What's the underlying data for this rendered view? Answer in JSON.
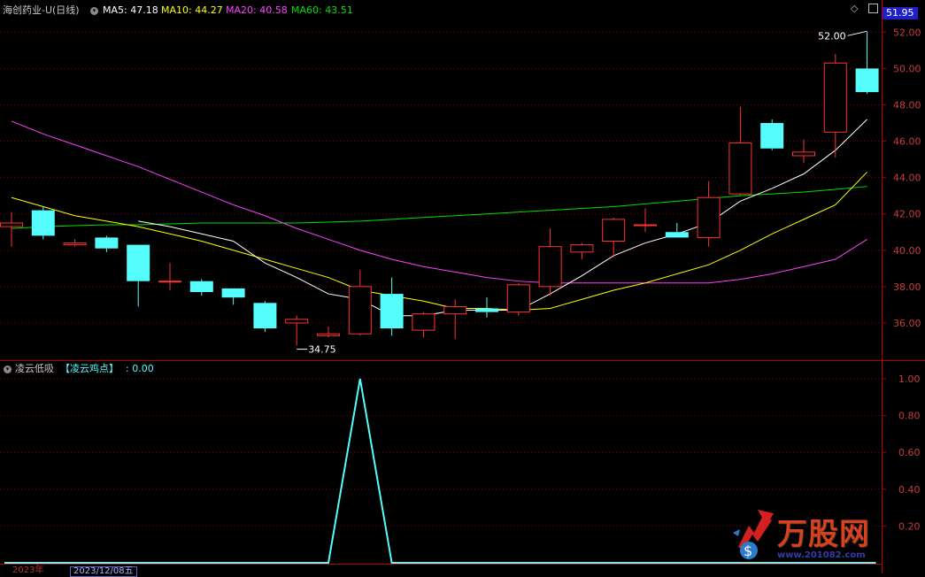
{
  "header": {
    "stock_name": "海创药业-U(日线)",
    "ma": [
      {
        "label": "MA5: 47.18",
        "color": "#ffffff"
      },
      {
        "label": "MA10: 44.27",
        "color": "#ffff00"
      },
      {
        "label": "MA20: 40.58",
        "color": "#ff40ff"
      },
      {
        "label": "MA60: 43.51",
        "color": "#00e000"
      }
    ],
    "last_price": "51.95"
  },
  "indicator": {
    "name": "凌云低吸",
    "series_label": "【凌云鸡点】",
    "value_label": ": 0.00"
  },
  "bottom_bar": {
    "year_label": "2023年",
    "date_label": "2023/12/08五"
  },
  "watermark": {
    "text": "万股网",
    "url": "www.201082.com"
  },
  "colors": {
    "up": "#ff3232",
    "down": "#54fcfc",
    "grid": "#7a0000",
    "axis": "#b00000",
    "axis_text": "#c83c3c",
    "ma5": "#ffffff",
    "ma10": "#ffff00",
    "ma20": "#ff40ff",
    "ma60": "#00e000",
    "indicator": "#54fcfc",
    "name": "#c8c8c8",
    "indicator_text": "#54fcfc"
  },
  "chart_data": [
    {
      "type": "candlestick",
      "title": "海创药业-U(日线)",
      "ylim": [
        34.0,
        52.6
      ],
      "y_ticks": [
        36.0,
        38.0,
        40.0,
        42.0,
        44.0,
        46.0,
        48.0,
        50.0,
        52.0
      ],
      "candles": [
        {
          "o": 41.3,
          "h": 42.1,
          "l": 40.2,
          "c": 41.5
        },
        {
          "o": 42.2,
          "h": 42.4,
          "l": 40.6,
          "c": 40.8
        },
        {
          "o": 40.3,
          "h": 40.6,
          "l": 40.2,
          "c": 40.4
        },
        {
          "o": 40.7,
          "h": 40.8,
          "l": 39.9,
          "c": 40.1
        },
        {
          "o": 40.3,
          "h": 40.3,
          "l": 36.9,
          "c": 38.3
        },
        {
          "o": 38.3,
          "h": 39.3,
          "l": 37.8,
          "c": 38.3
        },
        {
          "o": 38.3,
          "h": 38.4,
          "l": 37.5,
          "c": 37.7
        },
        {
          "o": 37.9,
          "h": 37.9,
          "l": 37.0,
          "c": 37.4
        },
        {
          "o": 37.1,
          "h": 37.2,
          "l": 35.5,
          "c": 35.7
        },
        {
          "o": 36.0,
          "h": 36.4,
          "l": 34.75,
          "c": 36.2
        },
        {
          "o": 35.3,
          "h": 35.8,
          "l": 35.2,
          "c": 35.4
        },
        {
          "o": 35.4,
          "h": 38.9,
          "l": 35.3,
          "c": 38.0
        },
        {
          "o": 37.6,
          "h": 38.5,
          "l": 35.3,
          "c": 35.7
        },
        {
          "o": 35.6,
          "h": 36.6,
          "l": 35.2,
          "c": 36.5
        },
        {
          "o": 36.5,
          "h": 37.3,
          "l": 35.1,
          "c": 36.9
        },
        {
          "o": 36.8,
          "h": 37.4,
          "l": 36.3,
          "c": 36.6
        },
        {
          "o": 36.6,
          "h": 38.2,
          "l": 36.4,
          "c": 38.1
        },
        {
          "o": 38.0,
          "h": 41.2,
          "l": 37.5,
          "c": 40.2
        },
        {
          "o": 39.9,
          "h": 40.4,
          "l": 39.5,
          "c": 40.3
        },
        {
          "o": 40.5,
          "h": 41.8,
          "l": 39.6,
          "c": 41.7
        },
        {
          "o": 41.4,
          "h": 42.3,
          "l": 41.0,
          "c": 41.4
        },
        {
          "o": 41.0,
          "h": 41.5,
          "l": 40.8,
          "c": 40.7
        },
        {
          "o": 40.7,
          "h": 43.8,
          "l": 40.2,
          "c": 42.9
        },
        {
          "o": 43.1,
          "h": 47.9,
          "l": 43.0,
          "c": 45.9
        },
        {
          "o": 47.0,
          "h": 47.2,
          "l": 45.5,
          "c": 45.6
        },
        {
          "o": 45.2,
          "h": 46.1,
          "l": 44.8,
          "c": 45.4
        },
        {
          "o": 46.5,
          "h": 50.8,
          "l": 45.1,
          "c": 50.3
        },
        {
          "o": 50.0,
          "h": 52.0,
          "l": 48.6,
          "c": 48.7
        }
      ],
      "ma5": [
        null,
        null,
        null,
        null,
        41.6,
        41.3,
        40.9,
        40.5,
        39.3,
        38.5,
        37.6,
        37.3,
        36.4,
        36.4,
        36.7,
        36.7,
        36.7,
        37.6,
        38.6,
        39.7,
        40.4,
        40.9,
        41.5,
        42.7,
        43.4,
        44.2,
        45.5,
        47.2
      ],
      "ma10": [
        42.9,
        42.4,
        41.9,
        41.6,
        41.3,
        40.9,
        40.5,
        40.0,
        39.5,
        39.0,
        38.5,
        37.8,
        37.5,
        37.2,
        36.8,
        36.8,
        36.7,
        36.8,
        37.3,
        37.8,
        38.2,
        38.7,
        39.2,
        40.0,
        40.9,
        41.7,
        42.5,
        44.3
      ],
      "ma20": [
        47.1,
        46.4,
        45.8,
        45.2,
        44.6,
        43.9,
        43.2,
        42.5,
        41.9,
        41.2,
        40.6,
        40.0,
        39.5,
        39.1,
        38.8,
        38.5,
        38.3,
        38.2,
        38.2,
        38.2,
        38.2,
        38.2,
        38.2,
        38.4,
        38.7,
        39.1,
        39.5,
        40.6
      ],
      "ma60": [
        41.2,
        41.3,
        41.35,
        41.4,
        41.4,
        41.45,
        41.5,
        41.5,
        41.5,
        41.5,
        41.55,
        41.6,
        41.7,
        41.8,
        41.9,
        42.0,
        42.1,
        42.2,
        42.3,
        42.4,
        42.55,
        42.7,
        42.85,
        43.0,
        43.1,
        43.2,
        43.35,
        43.51
      ],
      "annotations": [
        {
          "label": "34.75",
          "index": 9,
          "value": 34.75
        },
        {
          "label": "52.00",
          "index": 27,
          "value": 52.0
        }
      ]
    },
    {
      "type": "line",
      "name": "【凌云鸡点】",
      "ylim": [
        0.0,
        1.0
      ],
      "y_ticks": [
        "1.00",
        "0.80",
        "0.60",
        "0.40",
        "0.20"
      ],
      "values": [
        0,
        0,
        0,
        0,
        0,
        0,
        0,
        0,
        0,
        0,
        0,
        1,
        0,
        0,
        0,
        0,
        0,
        0,
        0,
        0,
        0,
        0,
        0,
        0,
        0,
        0,
        0,
        0
      ]
    }
  ]
}
